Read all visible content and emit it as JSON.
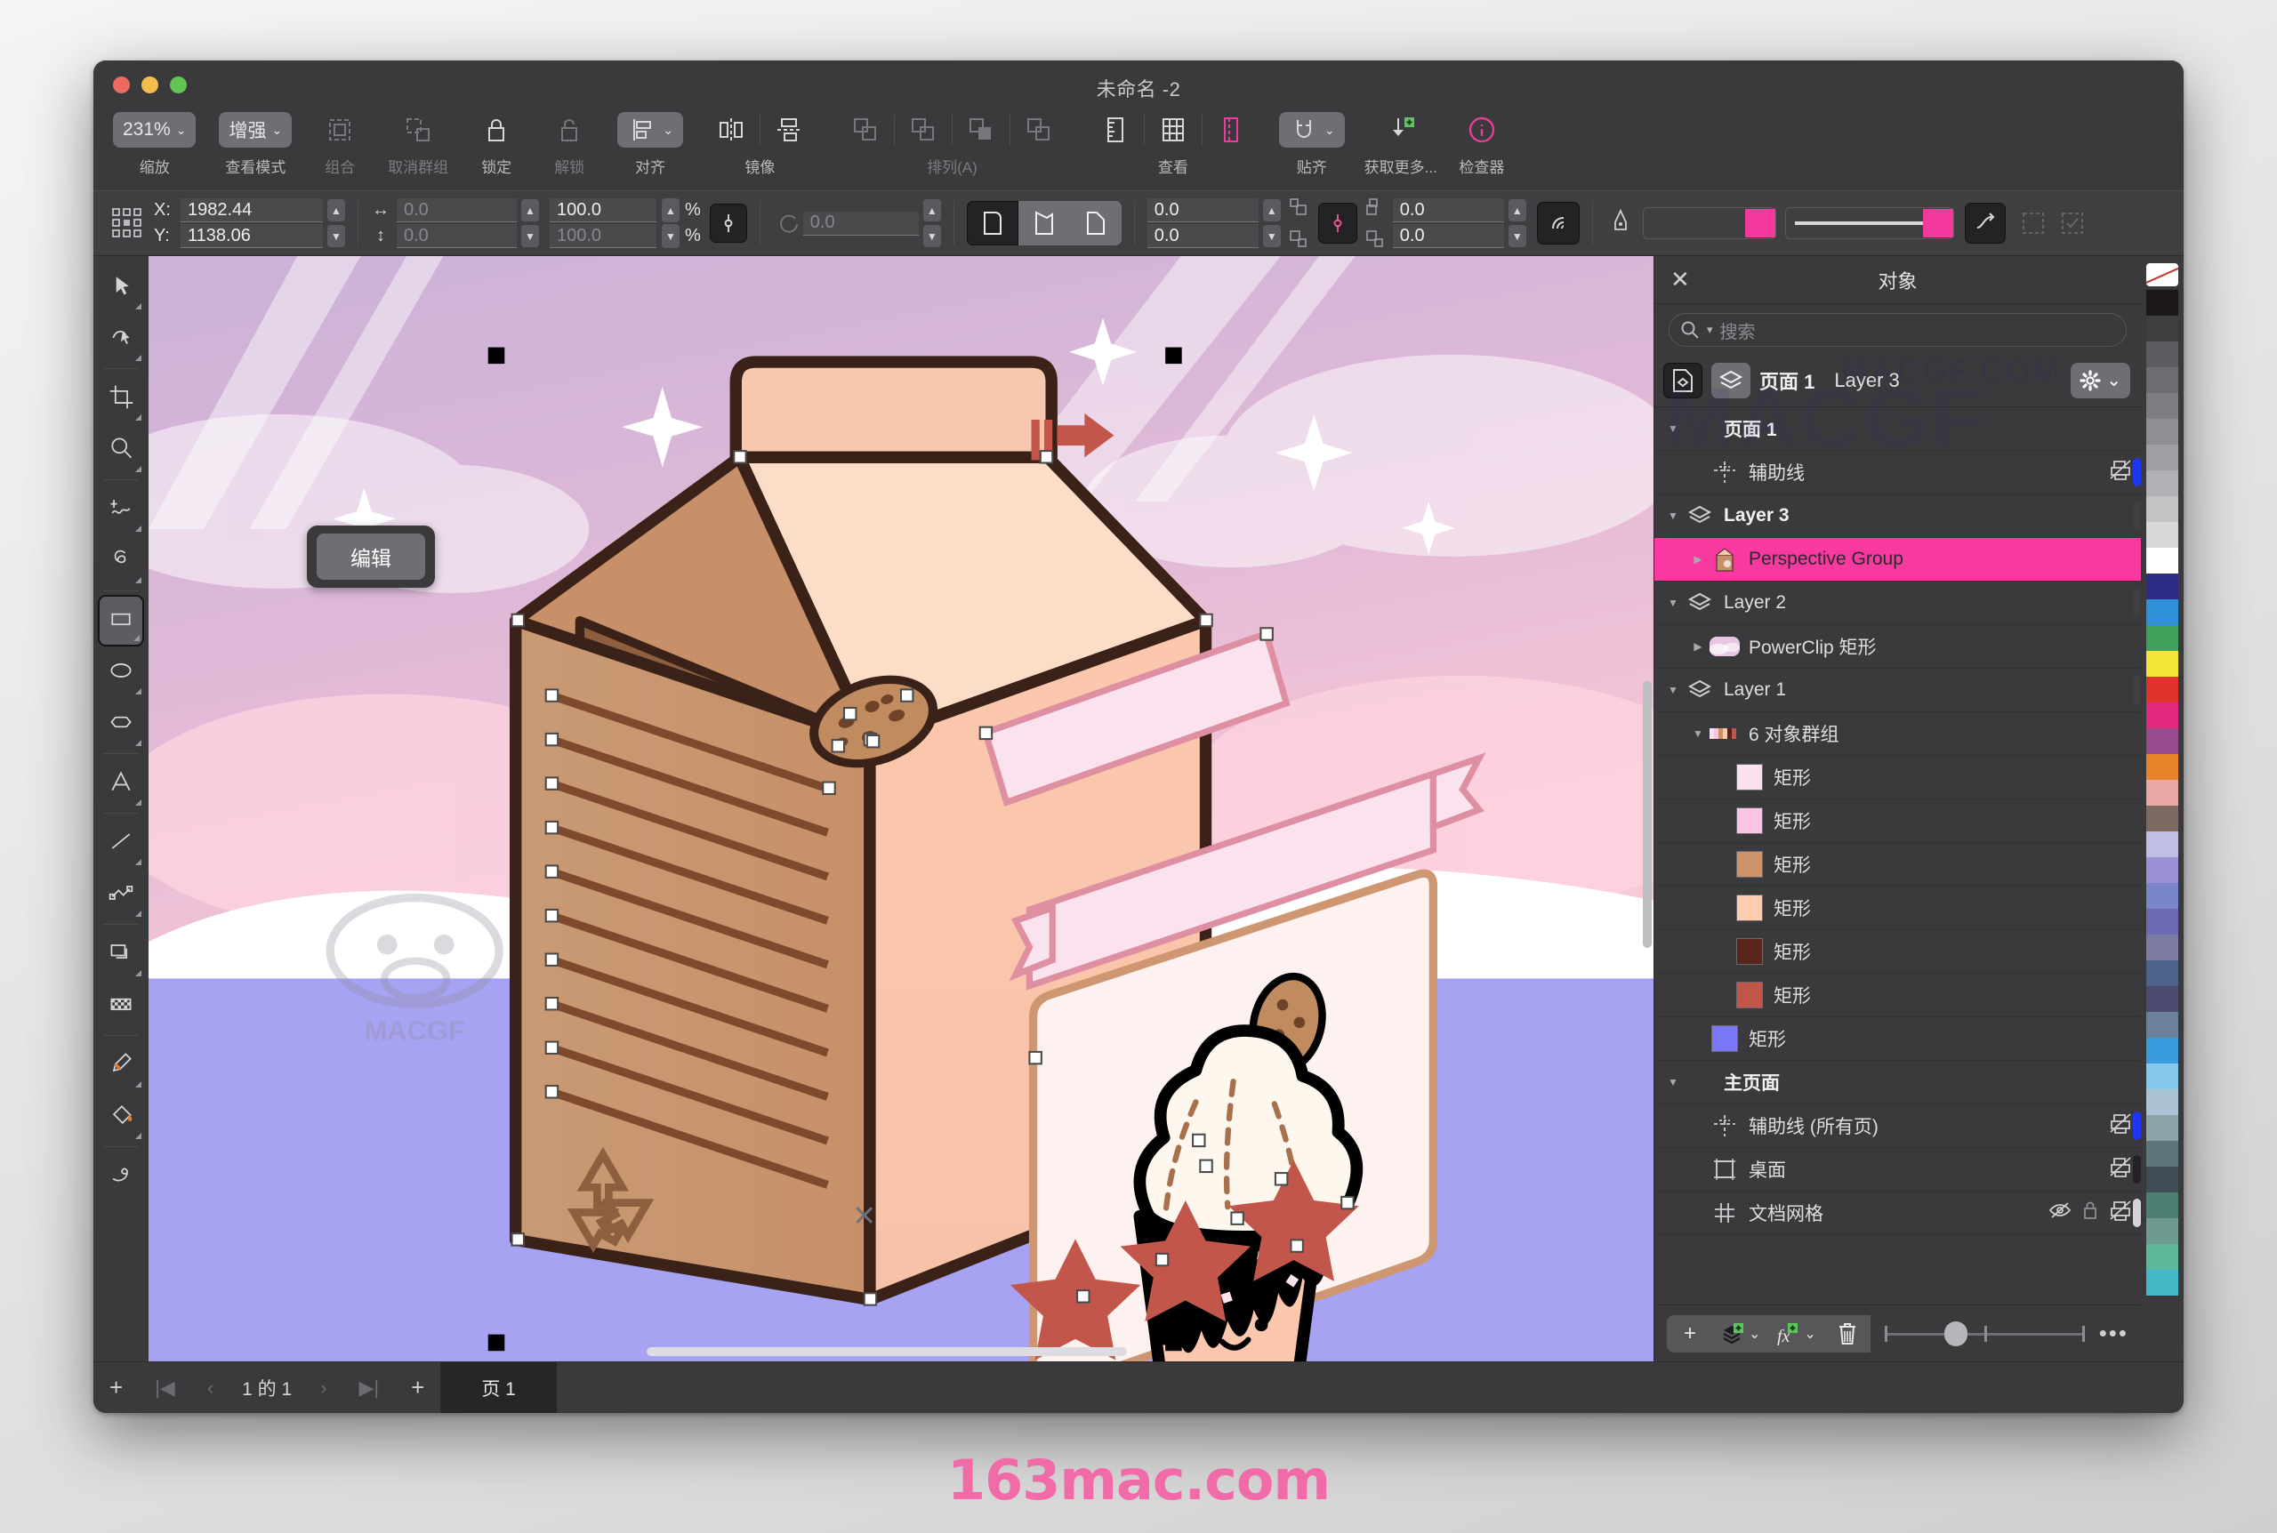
{
  "window": {
    "title": "未命名 -2"
  },
  "toolbar": {
    "groups": [
      {
        "label": "缩放",
        "dim": false,
        "items": [
          {
            "name": "zoom-level-dropdown",
            "text": "231%",
            "filled": true,
            "chevron": true
          }
        ]
      },
      {
        "label": "查看模式",
        "dim": false,
        "items": [
          {
            "name": "view-mode-dropdown",
            "text": "增强",
            "filled": true,
            "chevron": true
          }
        ]
      },
      {
        "label": "组合",
        "dim": true,
        "items": [
          {
            "name": "group-button",
            "icon": "group-icon"
          }
        ]
      },
      {
        "label": "取消群组",
        "dim": true,
        "items": [
          {
            "name": "ungroup-button",
            "icon": "ungroup-icon"
          }
        ]
      },
      {
        "label": "锁定",
        "dim": false,
        "items": [
          {
            "name": "lock-button",
            "icon": "lock-closed-icon"
          }
        ]
      },
      {
        "label": "解锁",
        "dim": true,
        "items": [
          {
            "name": "unlock-button",
            "icon": "lock-open-icon"
          }
        ]
      },
      {
        "label": "对齐",
        "dim": false,
        "items": [
          {
            "name": "align-dropdown",
            "icon": "align-left-icon",
            "filled": true,
            "chevron": true
          }
        ]
      },
      {
        "label": "镜像",
        "dim": false,
        "items": [
          {
            "name": "mirror-horizontal-button",
            "icon": "mirror-h-icon"
          },
          {
            "name": "mirror-vertical-button",
            "icon": "mirror-v-icon"
          }
        ]
      },
      {
        "label": "排列(A)",
        "dim": true,
        "items": [
          {
            "name": "order-front-button",
            "icon": "order-1-icon"
          },
          {
            "name": "order-forward-button",
            "icon": "order-2-icon"
          },
          {
            "name": "order-backward-button",
            "icon": "order-3-icon"
          },
          {
            "name": "order-back-button",
            "icon": "order-4-icon"
          }
        ]
      },
      {
        "label": "查看",
        "dim": false,
        "items": [
          {
            "name": "rulers-button",
            "icon": "ruler-icon"
          },
          {
            "name": "grid-button",
            "icon": "grid-icon"
          },
          {
            "name": "guides-button",
            "icon": "guides-icon",
            "accent": true
          }
        ]
      },
      {
        "label": "贴齐",
        "dim": false,
        "items": [
          {
            "name": "snap-dropdown",
            "icon": "magnet-icon",
            "filled": true,
            "chevron": true
          }
        ]
      },
      {
        "label": "获取更多...",
        "dim": false,
        "items": [
          {
            "name": "get-more-button",
            "icon": "download-plus-icon"
          }
        ]
      },
      {
        "label": "检查器",
        "dim": false,
        "items": [
          {
            "name": "inspector-button",
            "icon": "info-circle-icon",
            "accent": true
          }
        ]
      }
    ]
  },
  "propbar": {
    "position_icon": "anchor-grid-icon",
    "x_label": "X:",
    "y_label": "Y:",
    "x_value": "1982.44",
    "y_value": "1138.06",
    "width_value": "0.0",
    "height_value": "0.0",
    "scale_w_value": "100.0",
    "scale_h_value": "100.0",
    "percent_symbol": "%",
    "rotation_value": "0.0",
    "corner_tl_value": "0.0",
    "corner_bl_value": "0.0",
    "corner_tr_value": "0.0",
    "corner_br_value": "0.0",
    "outline_color": "#f4399c",
    "fill_color": "#f4399c"
  },
  "tools": [
    {
      "name": "tool-pick",
      "icon": "arrow-cursor-icon",
      "flag": true,
      "active": false
    },
    {
      "name": "tool-shape-edit",
      "icon": "node-edit-icon",
      "flag": true,
      "active": false
    },
    {
      "name": "tool-crop",
      "icon": "crop-icon",
      "flag": true,
      "active": false
    },
    {
      "name": "tool-zoom",
      "icon": "magnifier-icon",
      "flag": true,
      "active": false
    },
    {
      "name": "tool-freehand",
      "icon": "freehand-icon",
      "flag": true,
      "active": false
    },
    {
      "name": "tool-smart-draw",
      "icon": "smart-draw-icon",
      "flag": true,
      "active": false
    },
    {
      "name": "tool-rectangle",
      "icon": "rectangle-icon",
      "flag": true,
      "active": true
    },
    {
      "name": "tool-ellipse",
      "icon": "ellipse-icon",
      "flag": true,
      "active": false
    },
    {
      "name": "tool-polygon",
      "icon": "polygon-icon",
      "flag": true,
      "active": false
    },
    {
      "name": "tool-text",
      "icon": "text-a-icon",
      "flag": true,
      "active": false
    },
    {
      "name": "tool-line",
      "icon": "line-icon",
      "flag": true,
      "active": false
    },
    {
      "name": "tool-connector",
      "icon": "connector-icon",
      "flag": true,
      "active": false
    },
    {
      "name": "tool-shadow",
      "icon": "drop-shadow-icon",
      "flag": true,
      "active": false
    },
    {
      "name": "tool-transparency",
      "icon": "transparency-icon",
      "flag": false,
      "active": false
    },
    {
      "name": "tool-eyedropper",
      "icon": "eyedropper-icon",
      "flag": true,
      "active": false
    },
    {
      "name": "tool-fill",
      "icon": "paint-bucket-icon",
      "flag": true,
      "active": false
    },
    {
      "name": "tool-smear",
      "icon": "smear-icon",
      "flag": false,
      "active": false
    }
  ],
  "canvas": {
    "edit_popup_label": "编辑",
    "artwork": "milk carton illustration with cupcake, cookie, stars and pastel sky background",
    "watermark": "MACGF.COM"
  },
  "pagebar": {
    "add_left_label": "+",
    "first_label": "|◀",
    "prev_label": "‹",
    "counter": "1 的 1",
    "next_label": "›",
    "last_label": "▶|",
    "add_right_label": "+",
    "tab_label": "页 1"
  },
  "dock": {
    "title": "对象",
    "close_icon": "close-x-icon",
    "search_placeholder": "搜索",
    "layer_bar": {
      "page_label": "页面 1",
      "layer_label": "Layer 3",
      "gear_icon": "gear-icon"
    },
    "watermark": "MACGF.COM",
    "tree": [
      {
        "name": "tree-page-1",
        "indent": 0,
        "tri": "d",
        "icon": "none",
        "label": "页面 1",
        "bold": true,
        "selected": false
      },
      {
        "name": "tree-guides",
        "indent": 1,
        "tri": "",
        "icon": "guides-icon",
        "label": "辅助线",
        "bold": false,
        "selected": false,
        "print_icon": true,
        "colorbar": "#1e36f0"
      },
      {
        "name": "tree-layer-3",
        "indent": 0,
        "tri": "d",
        "icon": "layer-icon",
        "label": "Layer 3",
        "bold": true,
        "selected": false,
        "colorbar": "#3f3f42"
      },
      {
        "name": "tree-perspective-group",
        "indent": 1,
        "tri": "r",
        "icon": "thumb-carton",
        "label": "Perspective Group",
        "bold": false,
        "selected": true
      },
      {
        "name": "tree-layer-2",
        "indent": 0,
        "tri": "d",
        "icon": "layer-icon",
        "label": "Layer 2",
        "bold": false,
        "selected": false,
        "colorbar": "#3f3f42"
      },
      {
        "name": "tree-powerclip-rect",
        "indent": 1,
        "tri": "r",
        "icon": "thumb-sky",
        "label": "PowerClip 矩形",
        "bold": false,
        "selected": false
      },
      {
        "name": "tree-layer-1",
        "indent": 0,
        "tri": "d",
        "icon": "layer-icon",
        "label": "Layer 1",
        "bold": false,
        "selected": false,
        "colorbar": "#3f3f42"
      },
      {
        "name": "tree-group-6-objects",
        "indent": 1,
        "tri": "d",
        "icon": "thumb-strip",
        "label": "6 对象群组",
        "bold": false,
        "selected": false
      },
      {
        "name": "tree-rect-1",
        "indent": 2,
        "tri": "",
        "icon": "swatch",
        "color": "#fbe1f0",
        "label": "矩形",
        "bold": false,
        "selected": false
      },
      {
        "name": "tree-rect-2",
        "indent": 2,
        "tri": "",
        "icon": "swatch",
        "color": "#fbc3e4",
        "label": "矩形",
        "bold": false,
        "selected": false
      },
      {
        "name": "tree-rect-3",
        "indent": 2,
        "tri": "",
        "icon": "swatch",
        "color": "#cb9367",
        "label": "矩形",
        "bold": false,
        "selected": false
      },
      {
        "name": "tree-rect-4",
        "indent": 2,
        "tri": "",
        "icon": "swatch",
        "color": "#fccdae",
        "label": "矩形",
        "bold": false,
        "selected": false
      },
      {
        "name": "tree-rect-5",
        "indent": 2,
        "tri": "",
        "icon": "swatch",
        "color": "#5a241d",
        "label": "矩形",
        "bold": false,
        "selected": false
      },
      {
        "name": "tree-rect-6",
        "indent": 2,
        "tri": "",
        "icon": "swatch",
        "color": "#c2564b",
        "label": "矩形",
        "bold": false,
        "selected": false
      },
      {
        "name": "tree-rect-7",
        "indent": 1,
        "tri": "",
        "icon": "swatch",
        "color": "#7b78f7",
        "label": "矩形",
        "bold": false,
        "selected": false
      },
      {
        "name": "tree-master-page",
        "indent": 0,
        "tri": "d",
        "icon": "none",
        "label": "主页面",
        "bold": true,
        "selected": false
      },
      {
        "name": "tree-guides-all",
        "indent": 1,
        "tri": "",
        "icon": "guides-icon",
        "label": "辅助线 (所有页)",
        "bold": false,
        "selected": false,
        "print_icon": true,
        "colorbar": "#1e36f0"
      },
      {
        "name": "tree-desktop",
        "indent": 1,
        "tri": "",
        "icon": "desktop-icon",
        "label": "桌面",
        "bold": false,
        "selected": false,
        "print_icon": true,
        "colorbar": "#232325"
      },
      {
        "name": "tree-document-grid",
        "indent": 1,
        "tri": "",
        "icon": "grid-icon",
        "label": "文档网格",
        "bold": false,
        "selected": false,
        "eye_icon": true,
        "lock_icon": true,
        "print_icon": true,
        "colorbar": "#d5d5d8"
      }
    ],
    "footer": {
      "new_object_label": "+",
      "new_layer_icon": "new-layer-icon",
      "new_effect_icon": "new-effect-icon",
      "delete_icon": "trash-icon",
      "more_label": "•••"
    }
  },
  "palette": {
    "no_color": "none-swatch",
    "colors": [
      "#1c1719",
      "#3f3f42",
      "#5c5c60",
      "#6d6d71",
      "#7e7e82",
      "#8f8f93",
      "#a0a0a4",
      "#b1b1b5",
      "#c3c3c6",
      "#d8d8da",
      "#ffffff",
      "#2b2b87",
      "#2f8fd9",
      "#41a05c",
      "#f5e438",
      "#e0342b",
      "#e0297f",
      "#9a4a8e",
      "#e8832c",
      "#eaa8a4",
      "#7d6b63",
      "#c2bfe4",
      "#9b92d6",
      "#7b85c9",
      "#6c6ab3",
      "#7b7ba3",
      "#4c6289",
      "#4b4a70",
      "#6b8099",
      "#3a9ade",
      "#86c8ec",
      "#aac2d2",
      "#8fa3ad",
      "#5f737c",
      "#3f4e54",
      "#4e7d74",
      "#6f9a92",
      "#5eb79b",
      "#43b8c6"
    ]
  },
  "site_watermark": "163mac.com"
}
